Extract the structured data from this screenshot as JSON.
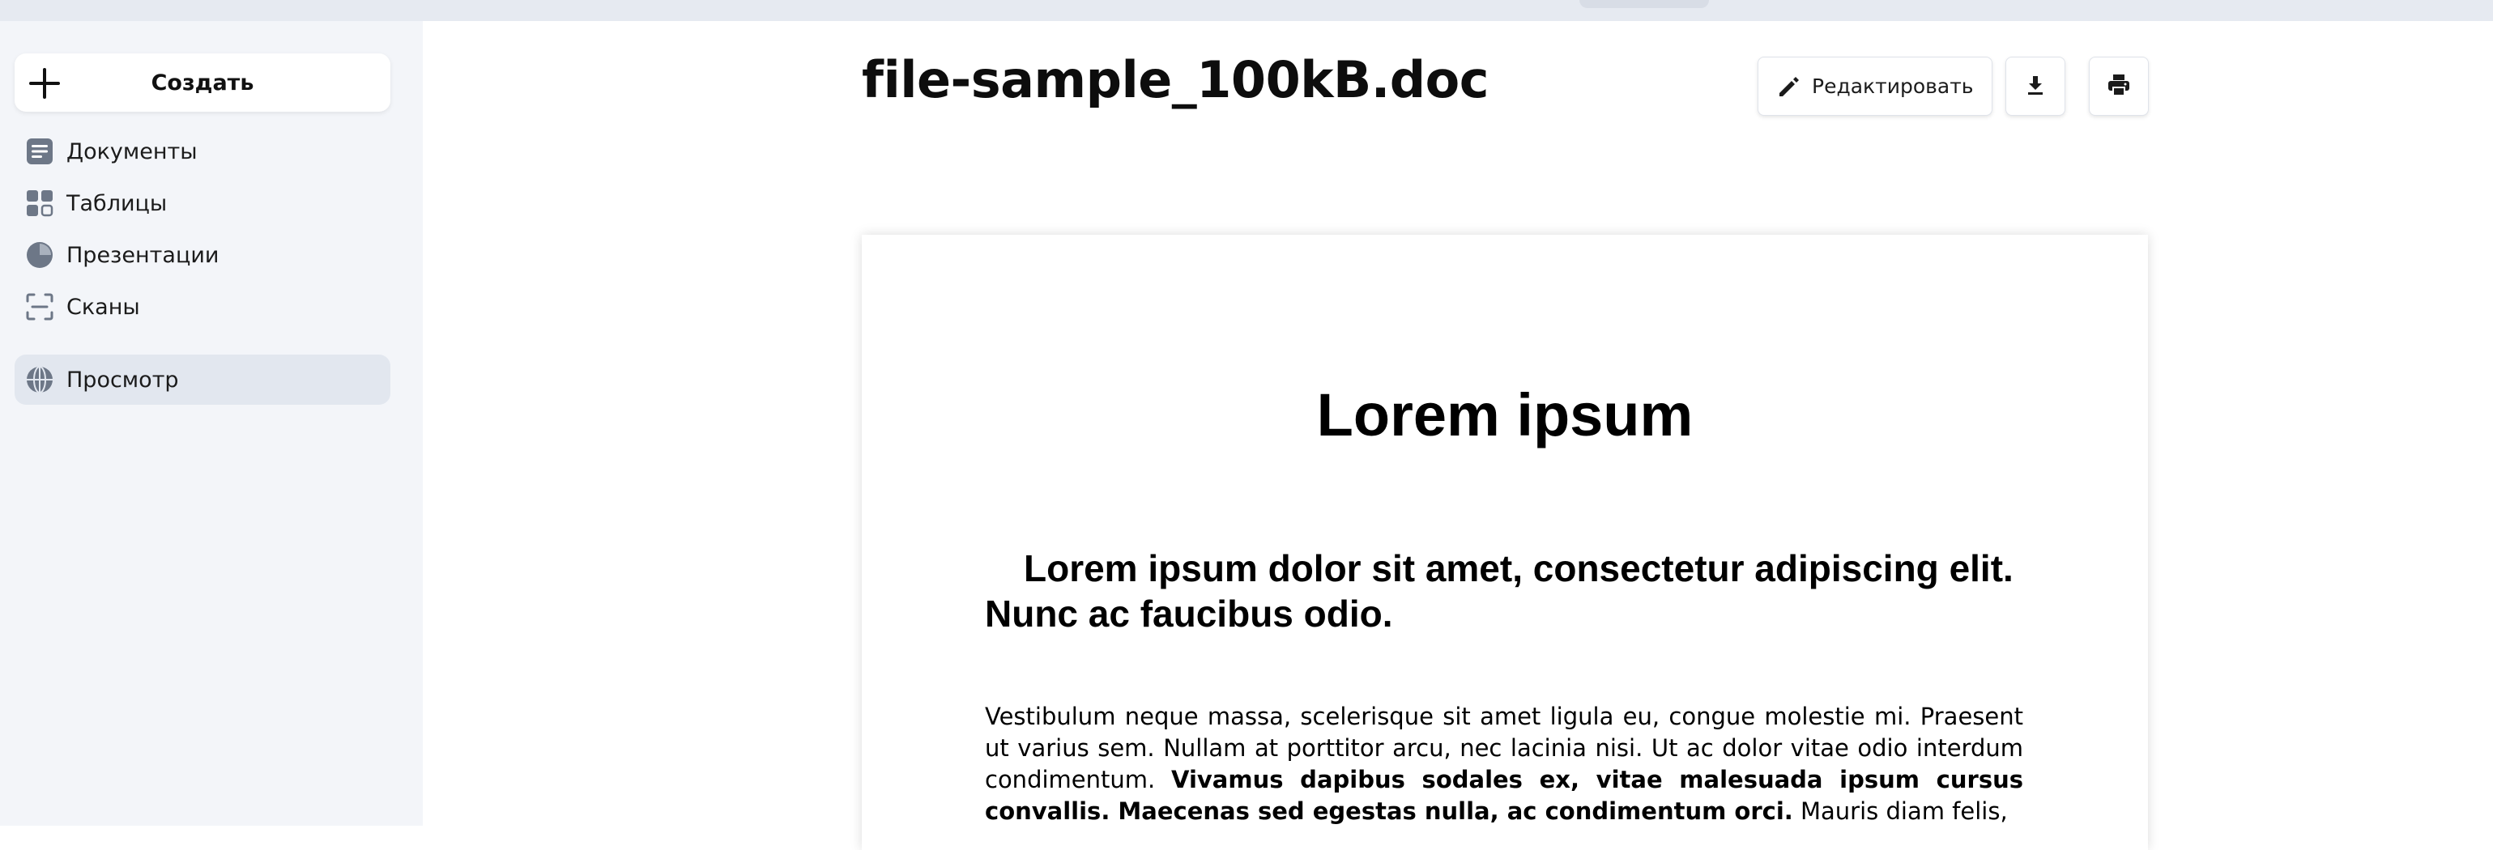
{
  "sidebar": {
    "create_label": "Создать",
    "items": [
      {
        "label": "Документы",
        "icon": "document-icon"
      },
      {
        "label": "Таблицы",
        "icon": "table-icon"
      },
      {
        "label": "Презентации",
        "icon": "presentation-icon"
      },
      {
        "label": "Сканы",
        "icon": "scan-icon"
      },
      {
        "label": "Просмотр",
        "icon": "globe-icon",
        "active": true
      }
    ]
  },
  "header": {
    "title": "file-sample_100kB.doc",
    "edit_label": "Редактировать"
  },
  "document": {
    "heading": "Lorem ipsum",
    "subheading": "Lorem ipsum dolor sit amet, consectetur adipiscing elit. Nunc ac faucibus odio.",
    "paragraph_part1": "Vestibulum neque massa, scelerisque sit amet ligula eu, congue molestie mi. Praesent ut varius sem. Nullam at porttitor arcu, nec lacinia nisi. Ut ac dolor vitae odio interdum condimentum. ",
    "paragraph_bold": "Vivamus dapibus sodales ex, vitae malesuada ipsum cursus convallis. Maecenas sed egestas nulla, ac condimentum orci.",
    "paragraph_part2": " Mauris diam felis,"
  },
  "colors": {
    "sidebar_bg": "#f3f5f9",
    "active_item_bg": "#e2e7ef",
    "icon_gray": "#6d7787"
  }
}
